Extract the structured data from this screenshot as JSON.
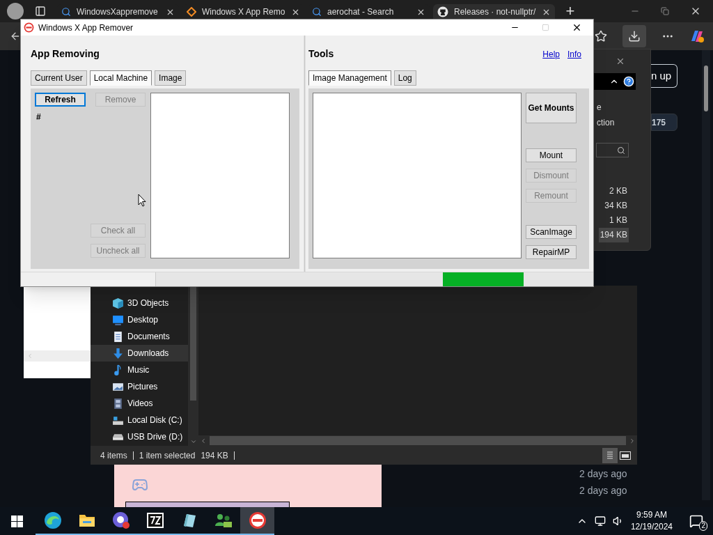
{
  "browser": {
    "tabs": [
      {
        "kind": "search",
        "title": "WindowsXappremove",
        "selected": false
      },
      {
        "kind": "site",
        "title": "Windows X App Remo",
        "selected": false
      },
      {
        "kind": "search",
        "title": "aerochat - Search",
        "selected": false
      },
      {
        "kind": "repo",
        "title": "Releases · not-nullptr/",
        "selected": true
      }
    ],
    "new_tab": "+"
  },
  "page": {
    "signup_partial": "n up",
    "counter_partial": "175",
    "dates": [
      "2 days ago",
      "2 days ago"
    ]
  },
  "downloads_panel": {
    "texts": [
      "e",
      "ction"
    ],
    "sizes": [
      {
        "text": "2 KB",
        "selected": false
      },
      {
        "text": "34 KB",
        "selected": false
      },
      {
        "text": "1 KB",
        "selected": false
      },
      {
        "text": "194 KB",
        "selected": true
      }
    ]
  },
  "app": {
    "title": "Windows X App Remover",
    "left": {
      "heading": "App Removing",
      "tabs": [
        {
          "label": "Current User",
          "selected": false
        },
        {
          "label": "Local Machine",
          "selected": true
        },
        {
          "label": "Image",
          "selected": false
        }
      ],
      "refresh": {
        "label": "Refresh",
        "disabled": false,
        "focused": true
      },
      "remove": {
        "label": "Remove",
        "disabled": true
      },
      "count_label": "#",
      "check_all": {
        "label": "Check all",
        "disabled": true
      },
      "uncheck_all": {
        "label": "Uncheck all",
        "disabled": true
      }
    },
    "right": {
      "heading": "Tools",
      "links": [
        "Help",
        "Info"
      ],
      "tabs": [
        {
          "label": "Image Management",
          "selected": true
        },
        {
          "label": "Log",
          "selected": false
        }
      ],
      "buttons": [
        {
          "label": "Get Mounts",
          "disabled": false,
          "kind": "large"
        },
        {
          "label": "Mount",
          "disabled": false,
          "kind": "normal"
        },
        {
          "label": "Dismount",
          "disabled": true,
          "kind": "normal"
        },
        {
          "label": "Remount",
          "disabled": true,
          "kind": "normal"
        },
        {
          "label": "ScanImage",
          "disabled": false,
          "kind": "normal"
        },
        {
          "label": "RepairMP",
          "disabled": false,
          "kind": "normal"
        }
      ]
    },
    "progress": {
      "kind": "marquee"
    }
  },
  "explorer": {
    "nav": [
      {
        "kind": "cube",
        "label": "3D Objects",
        "selected": false
      },
      {
        "kind": "desktop",
        "label": "Desktop",
        "selected": false
      },
      {
        "kind": "document",
        "label": "Documents",
        "selected": false
      },
      {
        "kind": "download",
        "label": "Downloads",
        "selected": true
      },
      {
        "kind": "music",
        "label": "Music",
        "selected": false
      },
      {
        "kind": "pictures",
        "label": "Pictures",
        "selected": false
      },
      {
        "kind": "videos",
        "label": "Videos",
        "selected": false
      },
      {
        "kind": "disk",
        "label": "Local Disk (C:)",
        "selected": false
      },
      {
        "kind": "usb",
        "label": "USB Drive (D:)",
        "selected": false
      }
    ],
    "status": {
      "items": "4 items",
      "selection": "1 item selected",
      "size": "194 KB"
    },
    "views": [
      {
        "kind": "details",
        "selected": true
      },
      {
        "kind": "tiles",
        "selected": false
      }
    ]
  },
  "taskbar": {
    "apps": [
      {
        "kind": "browser",
        "selected": false
      },
      {
        "kind": "folder",
        "selected": false
      },
      {
        "kind": "chat",
        "selected": false
      },
      {
        "kind": "archive",
        "selected": false
      },
      {
        "kind": "notepad",
        "selected": false
      },
      {
        "kind": "people",
        "selected": false
      },
      {
        "kind": "remover",
        "selected": true
      }
    ],
    "time": "9:59 AM",
    "date": "12/19/2024",
    "notifications": "2"
  }
}
